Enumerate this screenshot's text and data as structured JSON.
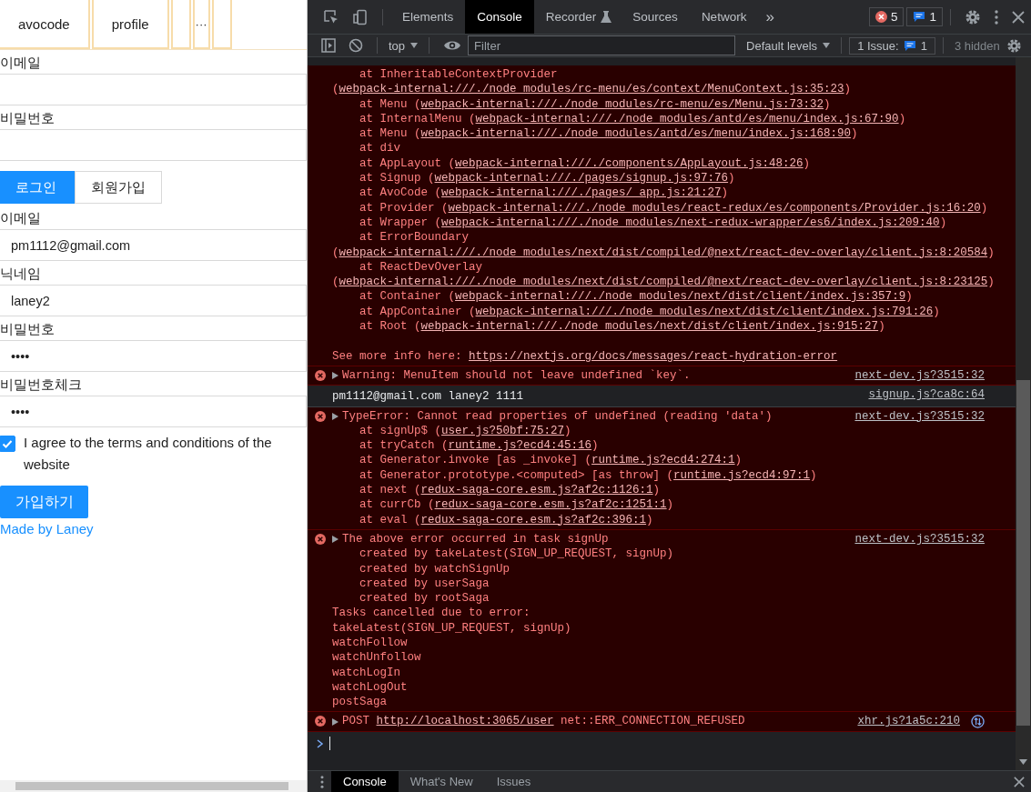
{
  "page": {
    "menu": [
      {
        "label": "avocode"
      },
      {
        "label": "profile"
      }
    ],
    "menu_overflow": "···",
    "login_form": {
      "fields": [
        {
          "label": "이메일"
        },
        {
          "label": "비밀번호"
        }
      ]
    },
    "tabs": [
      {
        "label": "로그인",
        "selected": true
      },
      {
        "label": "회원가입",
        "selected": false
      }
    ],
    "signup_form": {
      "fields": [
        {
          "label": "이메일",
          "value": "pm1112@gmail.com"
        },
        {
          "label": "닉네임",
          "value": "laney2"
        },
        {
          "label": "비밀번호",
          "value": "••••"
        },
        {
          "label": "비밀번호체크",
          "value": "••••"
        }
      ],
      "agree": {
        "label": "I agree to the terms and conditions of the website",
        "checked": true
      },
      "submit": "가입하기"
    },
    "footer_link": "Made by Laney"
  },
  "devtools": {
    "tabs": [
      {
        "label": "Elements",
        "selected": false
      },
      {
        "label": "Console",
        "selected": true
      },
      {
        "label": "Recorder",
        "selected": false
      },
      {
        "label": "Sources",
        "selected": false
      },
      {
        "label": "Network",
        "selected": false
      }
    ],
    "more_tabs": "»",
    "error_count": "5",
    "message_count": "1",
    "context": "top",
    "filter_placeholder": "Filter",
    "levels": "Default levels",
    "issues_label": "1 Issue:",
    "issues_count": "1",
    "hidden": "3 hidden",
    "messages": [
      {
        "kind": "error",
        "expandable": false,
        "lines": [
          [
            "    at InheritableContextProvider (",
            "webpack-internal:///./node_modules/rc-menu/es/context/MenuContext.js:35:23",
            ")"
          ],
          [
            "    at Menu (",
            "webpack-internal:///./node_modules/rc-menu/es/Menu.js:73:32",
            ")"
          ],
          [
            "    at InternalMenu (",
            "webpack-internal:///./node_modules/antd/es/menu/index.js:67:90",
            ")"
          ],
          [
            "    at Menu (",
            "webpack-internal:///./node_modules/antd/es/menu/index.js:168:90",
            ")"
          ],
          [
            "    at div"
          ],
          [
            "    at AppLayout (",
            "webpack-internal:///./components/AppLayout.js:48:26",
            ")"
          ],
          [
            "    at Signup (",
            "webpack-internal:///./pages/signup.js:97:76",
            ")"
          ],
          [
            "    at AvoCode (",
            "webpack-internal:///./pages/_app.js:21:27",
            ")"
          ],
          [
            "    at Provider (",
            "webpack-internal:///./node_modules/react-redux/es/components/Provider.js:16:20",
            ")"
          ],
          [
            "    at Wrapper (",
            "webpack-internal:///./node_modules/next-redux-wrapper/es6/index.js:209:40",
            ")"
          ],
          [
            "    at ErrorBoundary (",
            "webpack-internal:///./node_modules/next/dist/compiled/@next/react-dev-overlay/client.js:8:20584",
            ")"
          ],
          [
            "    at ReactDevOverlay (",
            "webpack-internal:///./node_modules/next/dist/compiled/@next/react-dev-overlay/client.js:8:23125",
            ")"
          ],
          [
            "    at Container (",
            "webpack-internal:///./node_modules/next/dist/client/index.js:357:9",
            ")"
          ],
          [
            "    at AppContainer (",
            "webpack-internal:///./node_modules/next/dist/client/index.js:791:26",
            ")"
          ],
          [
            "    at Root (",
            "webpack-internal:///./node_modules/next/dist/client/index.js:915:27",
            ")"
          ]
        ],
        "note": [
          "See more info here: ",
          "https://nextjs.org/docs/messages/react-hydration-error"
        ]
      },
      {
        "kind": "error",
        "expandable": true,
        "source": "next-dev.js?3515:32",
        "lines": [
          [
            "Warning: MenuItem should not leave undefined `key`."
          ]
        ]
      },
      {
        "kind": "log",
        "expandable": false,
        "source": "signup.js?ca8c:64",
        "lines": [
          [
            "pm1112@gmail.com laney2 1111"
          ]
        ]
      },
      {
        "kind": "error",
        "expandable": true,
        "source": "next-dev.js?3515:32",
        "lines": [
          [
            "TypeError: Cannot read properties of undefined (reading 'data')"
          ],
          [
            "    at signUp$ (",
            "user.js?50bf:75:27",
            ")"
          ],
          [
            "    at tryCatch (",
            "runtime.js?ecd4:45:16",
            ")"
          ],
          [
            "    at Generator.invoke [as _invoke] (",
            "runtime.js?ecd4:274:1",
            ")"
          ],
          [
            "    at Generator.prototype.<computed> [as throw] (",
            "runtime.js?ecd4:97:1",
            ")"
          ],
          [
            "    at next (",
            "redux-saga-core.esm.js?af2c:1126:1",
            ")"
          ],
          [
            "    at currCb (",
            "redux-saga-core.esm.js?af2c:1251:1",
            ")"
          ],
          [
            "    at eval (",
            "redux-saga-core.esm.js?af2c:396:1",
            ")"
          ]
        ]
      },
      {
        "kind": "error",
        "expandable": true,
        "source": "next-dev.js?3515:32",
        "lines": [
          [
            "The above error occurred in task signUp"
          ],
          [
            "    created by takeLatest(SIGN_UP_REQUEST, signUp)"
          ],
          [
            "    created by watchSignUp"
          ],
          [
            "    created by userSaga"
          ],
          [
            "    created by rootSaga"
          ],
          [
            "Tasks cancelled due to error:"
          ],
          [
            "takeLatest(SIGN_UP_REQUEST, signUp)"
          ],
          [
            "watchFollow"
          ],
          [
            "watchUnfollow"
          ],
          [
            "watchLogIn"
          ],
          [
            "watchLogOut"
          ],
          [
            "postSaga"
          ]
        ]
      },
      {
        "kind": "error",
        "expandable": true,
        "source": "xhr.js?1a5c:210",
        "request_icon": true,
        "lines": [
          [
            "POST ",
            "http://localhost:3065/user",
            " net::ERR_CONNECTION_REFUSED"
          ]
        ]
      }
    ],
    "drawer_tabs": [
      {
        "label": "Console",
        "selected": true
      },
      {
        "label": "What's New",
        "selected": false
      },
      {
        "label": "Issues",
        "selected": false
      }
    ]
  }
}
